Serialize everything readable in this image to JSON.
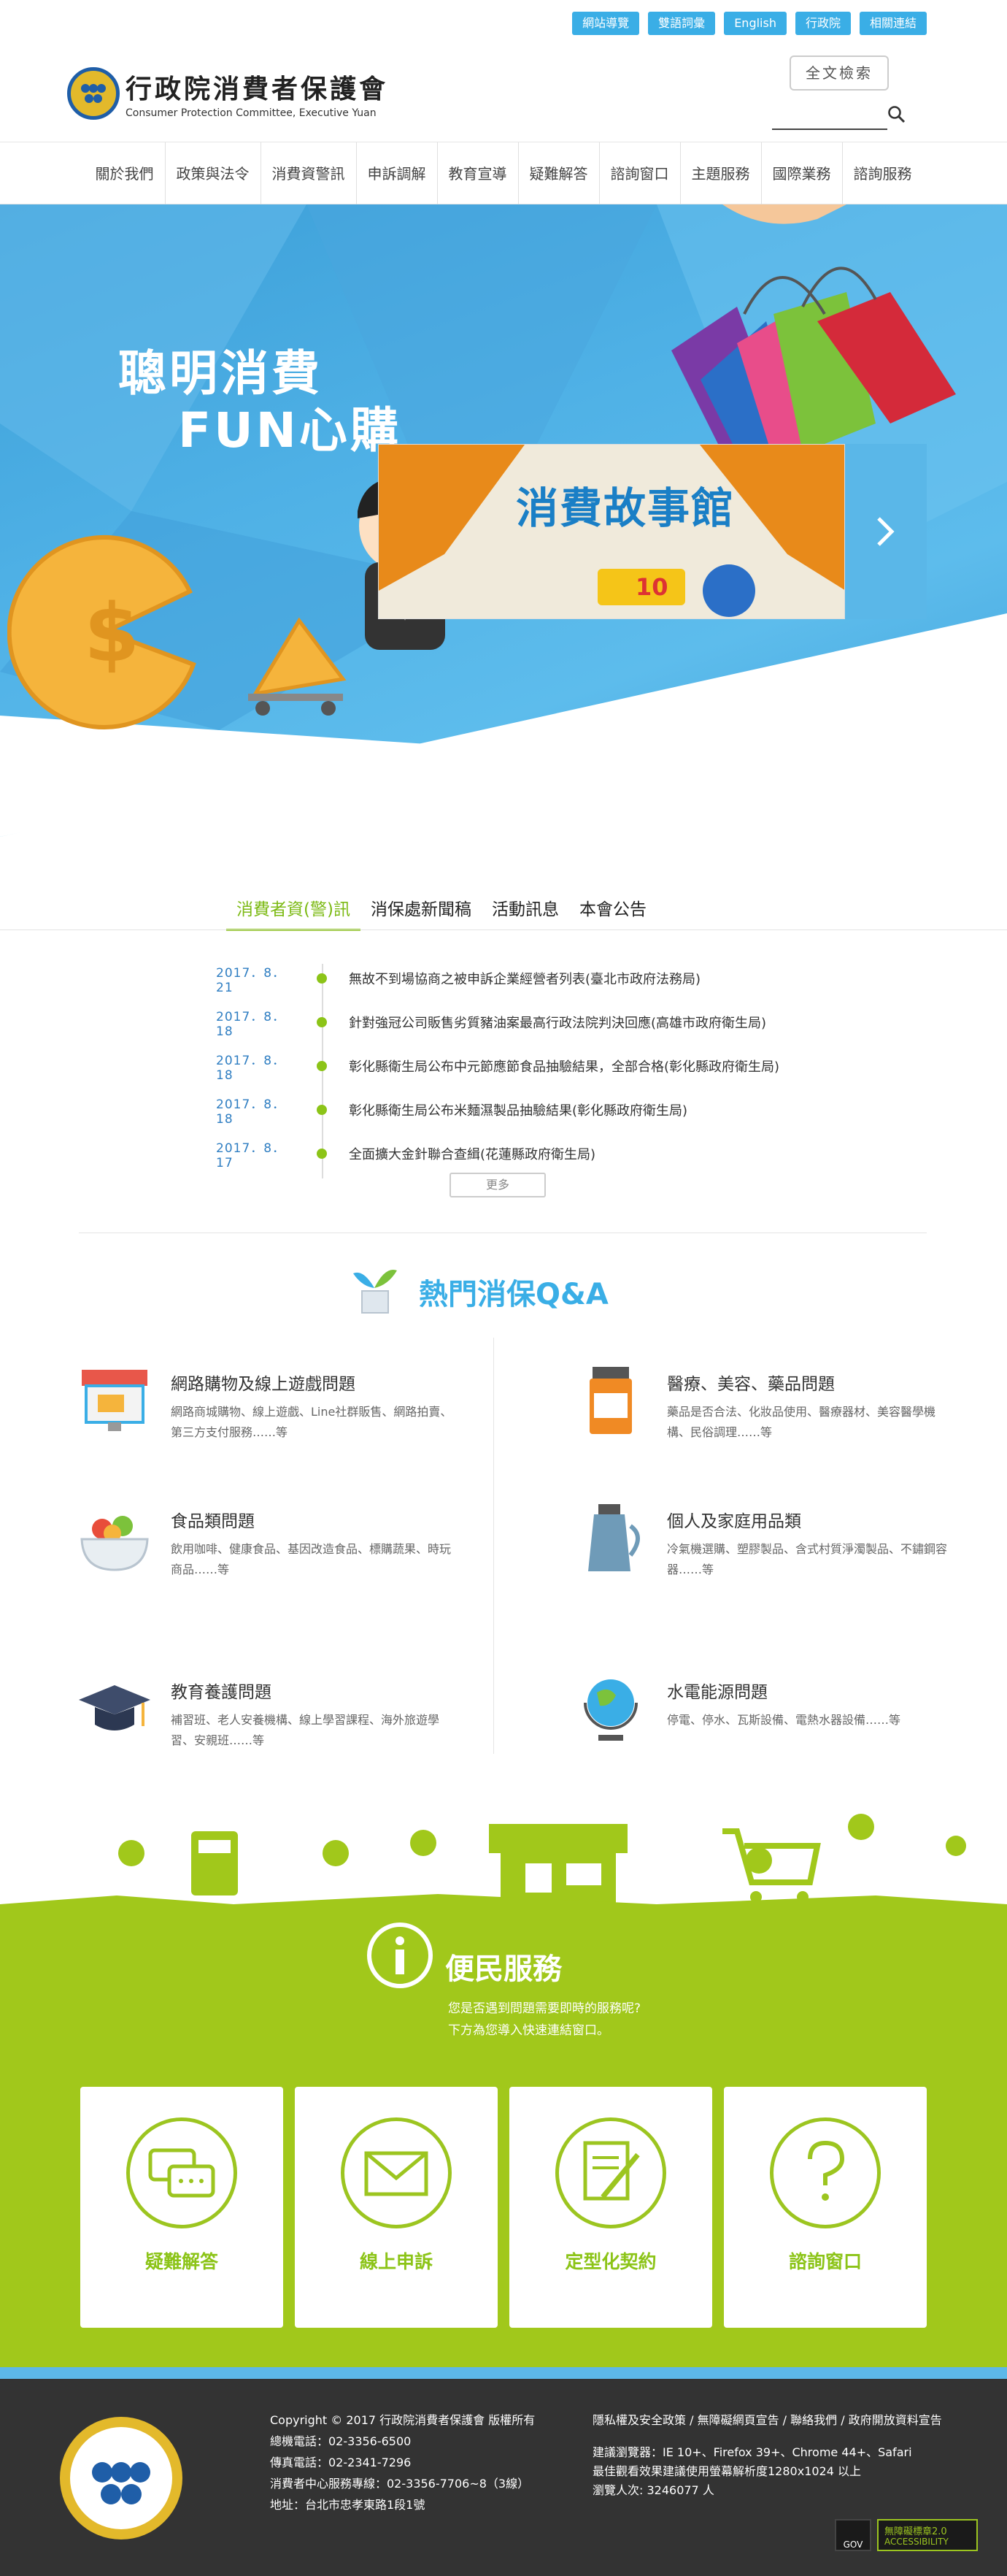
{
  "top_links": [
    "網站導覽",
    "雙語詞彙",
    "English",
    "行政院",
    "相關連結"
  ],
  "logo": {
    "title_cn": "行政院消費者保護會",
    "title_en": "Consumer Protection Committee, Executive Yuan"
  },
  "search": {
    "button_label": "全文檢索",
    "icon": "search-icon"
  },
  "nav": [
    "關於我們",
    "政策與法令",
    "消費資警訊",
    "申訴調解",
    "教育宣導",
    "疑難解答",
    "諮詢窗口",
    "主題服務",
    "國際業務",
    "諮詢服務"
  ],
  "hero": {
    "slogan_line1": "聰明消費",
    "slogan_line2": "FUN心購",
    "card_title": "消費故事館",
    "card_badge": "10",
    "next_icon": "chevron-right-icon"
  },
  "news": {
    "tabs": [
      "消費者資(警)訊",
      "消保處新聞稿",
      "活動訊息",
      "本會公告"
    ],
    "active_tab": 0,
    "items": [
      {
        "date": "2017．8．21",
        "title": "無故不到場協商之被申訴企業經營者列表(臺北市政府法務局)"
      },
      {
        "date": "2017．8．18",
        "title": "針對強冠公司販售劣質豬油案最高行政法院判決回應(高雄市政府衛生局)"
      },
      {
        "date": "2017．8．18",
        "title": "彰化縣衛生局公布中元節應節食品抽驗結果，全部合格(彰化縣政府衛生局)"
      },
      {
        "date": "2017．8．18",
        "title": "彰化縣衛生局公布米麵濕製品抽驗結果(彰化縣政府衛生局)"
      },
      {
        "date": "2017．8．17",
        "title": "全面擴大金針聯合查緝(花蓮縣政府衛生局)"
      }
    ],
    "more_label": "更多"
  },
  "qa": {
    "title": "熱門消保Q&A",
    "items": [
      {
        "title": "網路購物及線上遊戲問題",
        "desc": "網路商城購物、線上遊戲、Line社群販售、網路拍賣、第三方支付服務……等",
        "icon": "storefront-icon"
      },
      {
        "title": "醫療、美容、藥品問題",
        "desc": "藥品是否合法、化妝品使用、醫療器材、美容醫學機構、民俗調理……等",
        "icon": "medicine-bottle-icon"
      },
      {
        "title": "食品類問題",
        "desc": "飲用咖啡、健康食品、基因改造食品、標購蔬果、時玩商品……等",
        "icon": "food-bowl-icon"
      },
      {
        "title": "個人及家庭用品類",
        "desc": "冷氣機選購、塑膠製品、含式村質淨濁製品、不鏽鋼容器……等",
        "icon": "kettle-icon"
      },
      {
        "title": "教育養護問題",
        "desc": "補習班、老人安養機構、線上學習課程、海外旅遊學習、安親班……等",
        "icon": "graduation-cap-icon"
      },
      {
        "title": "水電能源問題",
        "desc": "停電、停水、瓦斯設備、電熱水器設備……等",
        "icon": "globe-icon"
      }
    ]
  },
  "service": {
    "title": "便民服務",
    "subtitle_line1": "您是否遇到問題需要即時的服務呢?",
    "subtitle_line2": "下方為您導入快速連結窗口。",
    "cards": [
      {
        "label": "疑難解答",
        "icon": "chat-bubbles-icon"
      },
      {
        "label": "線上申訴",
        "icon": "envelope-icon"
      },
      {
        "label": "定型化契約",
        "icon": "document-pen-icon"
      },
      {
        "label": "諮詢窗口",
        "icon": "question-mark-icon"
      }
    ]
  },
  "footer": {
    "copyright": "Copyright © 2017 行政院消費者保護會 版權所有",
    "phone": "總機電話：02-3356-6500",
    "fax": "傳真電話：02-2341-7296",
    "hotline": "消費者中心服務專線：02-3356-7706~8（3線）",
    "address": "地址：台北市忠孝東路1段1號",
    "links": [
      "隱私權及安全政策",
      "無障礙網頁宣告",
      "聯絡我們",
      "政府開放資料宣告"
    ],
    "browser": "建議瀏覽器：IE 10+、Firefox 39+、Chrome 44+、Safari",
    "resolution": "最佳觀看效果建議使用螢幕解析度1280x1024 以上",
    "visitors": "瀏覽人次: 3246077  人",
    "badge_gov": "GOV",
    "badge_access": "無障礙標章2.0",
    "badge_access_sub": "ACCESSIBILITY"
  },
  "colors": {
    "accent_blue": "#3aaee6",
    "accent_green": "#a1c81b",
    "footer_bg": "#333333"
  }
}
